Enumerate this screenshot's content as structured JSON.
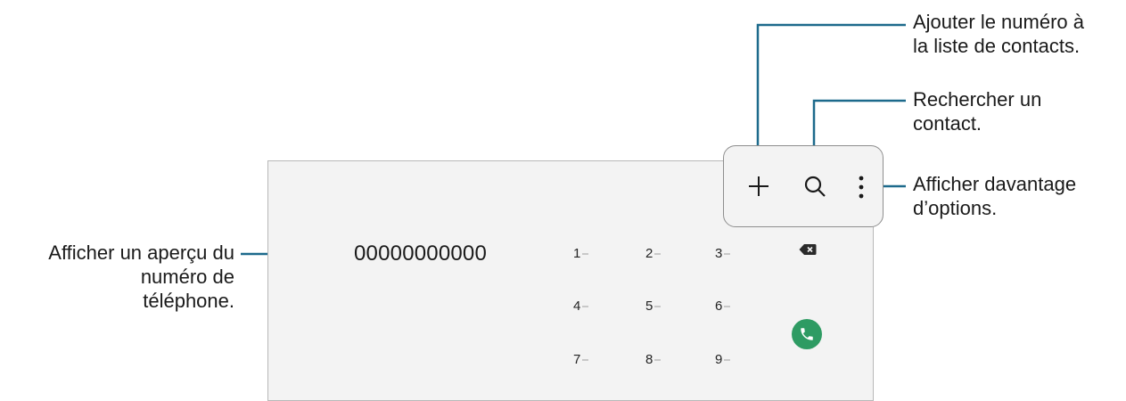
{
  "callouts": {
    "add_contact": [
      "Ajouter le numéro à",
      "la liste de contacts."
    ],
    "search": [
      "Rechercher un",
      "contact."
    ],
    "more_options": [
      "Afficher davantage",
      "d’options."
    ],
    "number_preview": [
      "Afficher un aperçu du",
      "numéro de",
      "téléphone."
    ]
  },
  "dialer": {
    "number_display": "00000000000",
    "keys": [
      "1",
      "2",
      "3",
      "4",
      "5",
      "6",
      "7",
      "8",
      "9"
    ]
  },
  "icons": {
    "add": "plus-icon",
    "search": "search-icon",
    "more": "more-vertical-icon",
    "backspace": "backspace-icon",
    "call": "phone-icon"
  },
  "colors": {
    "line_accent": "#1d6a8c",
    "call_green": "#2e9b63"
  }
}
